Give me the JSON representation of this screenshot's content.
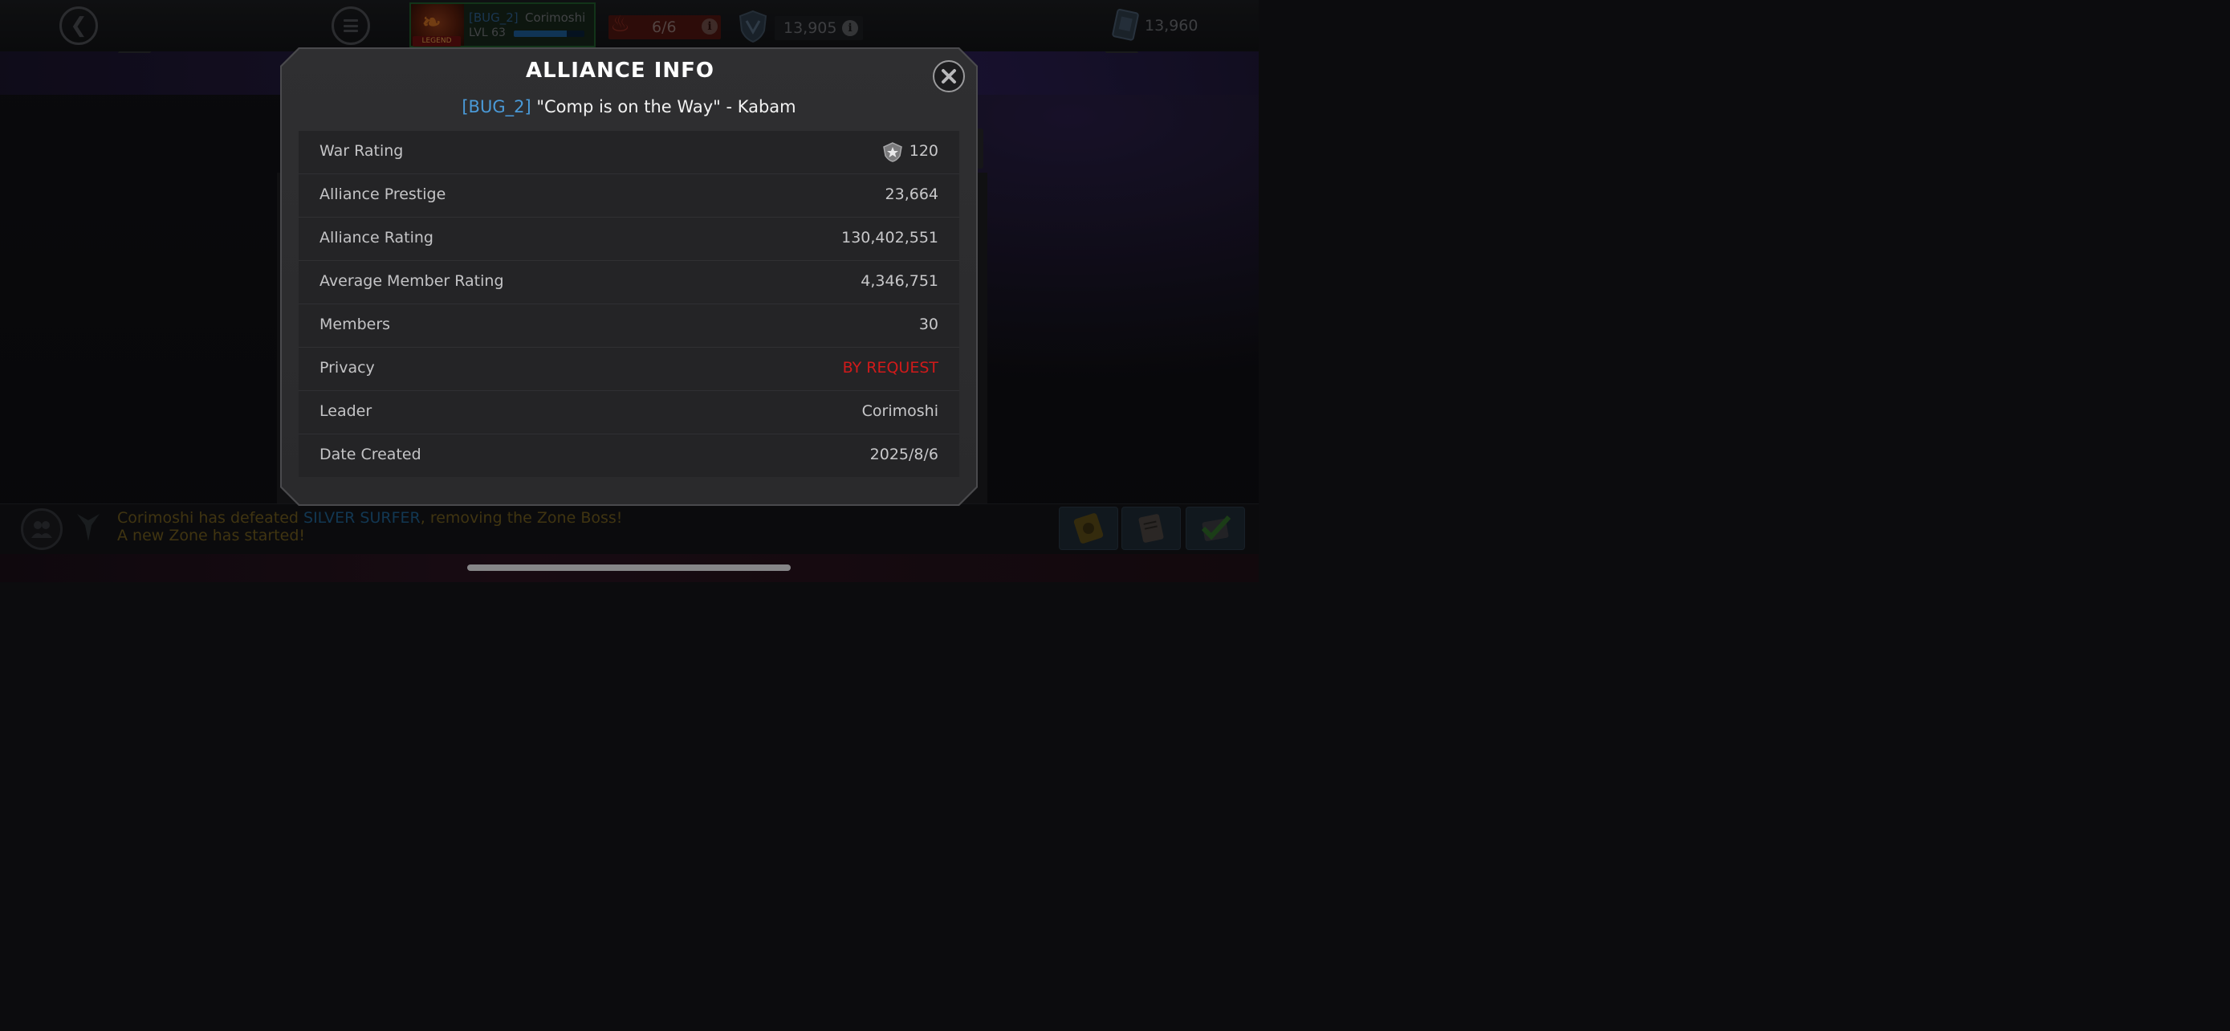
{
  "hud": {
    "profile_tag": "[BUG_2]",
    "profile_name": "Corimoshi",
    "level": "LVL 63",
    "legend_badge": "LEGEND",
    "xp_progress": 0.75,
    "energy": "6/6",
    "energy_info": "i",
    "shields": "13,905",
    "shields_info": "i",
    "cards": "13,960",
    "icons": [
      "back-icon",
      "menu-icon",
      "energy-icon",
      "shield-icon",
      "card-icon"
    ]
  },
  "modal": {
    "title": "ALLIANCE INFO",
    "tag": "[BUG_2]",
    "name": "\"Comp is on the Way\" - Kabam",
    "close_icon": "close-icon",
    "rows": [
      {
        "label": "War Rating",
        "value": "120"
      },
      {
        "label": "Alliance Prestige",
        "value": "23,664"
      },
      {
        "label": "Alliance Rating",
        "value": "130,402,551"
      },
      {
        "label": "Average Member Rating",
        "value": "4,346,751"
      },
      {
        "label": "Members",
        "value": "30"
      },
      {
        "label": "Privacy",
        "value": "BY REQUEST"
      },
      {
        "label": "Leader",
        "value": "Corimoshi"
      },
      {
        "label": "Date Created",
        "value": "2025/8/6"
      }
    ]
  },
  "feed": {
    "line1_prefix": "Corimoshi has defeated ",
    "line1_highlight": "SILVER SURFER",
    "line1_suffix": ", removing the Zone Boss!",
    "line2": "A new Zone has started!"
  },
  "colors": {
    "tag_blue": "#4a9ad8",
    "privacy_red": "#d11a1a",
    "modal_bg": "#2f2f31",
    "feed_gold": "#6e5b1e",
    "feed_blue": "#1f5f8e"
  }
}
